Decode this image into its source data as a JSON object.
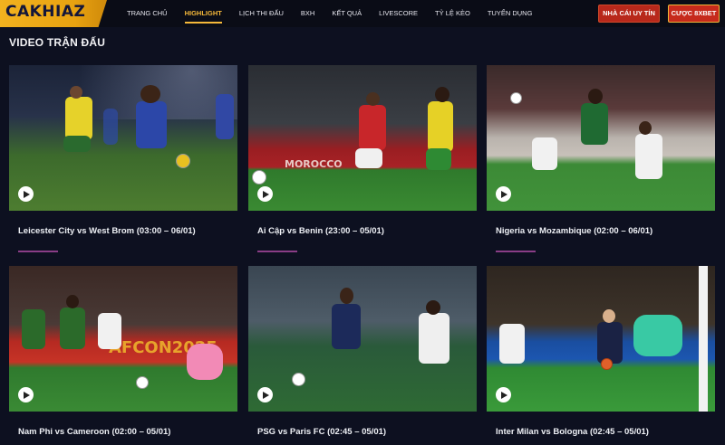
{
  "brand": {
    "logo_text": "CAKHIAZ"
  },
  "nav": {
    "items": [
      {
        "label": "TRANG CHỦ",
        "active": false
      },
      {
        "label": "HIGHLIGHT",
        "active": true
      },
      {
        "label": "LỊCH THI ĐẤU",
        "active": false
      },
      {
        "label": "BXH",
        "active": false
      },
      {
        "label": "KẾT QUẢ",
        "active": false
      },
      {
        "label": "LIVESCORE",
        "active": false
      },
      {
        "label": "TỶ LỆ KÈO",
        "active": false
      },
      {
        "label": "TUYỂN DỤNG",
        "active": false
      }
    ],
    "button_primary": "NHÀ CÁI UY TÍN",
    "button_secondary": "CƯỢC 8XBET"
  },
  "section": {
    "title": "VIDEO TRẬN ĐẤU"
  },
  "videos": [
    {
      "title": "Leicester City vs West Brom (03:00 – 06/01)"
    },
    {
      "title": "Ai Cập vs Benin (23:00 – 05/01)"
    },
    {
      "title": "Nigeria vs Mozambique (02:00 – 06/01)"
    },
    {
      "title": "Nam Phi vs Cameroon (02:00 – 05/01)"
    },
    {
      "title": "PSG vs Paris FC (02:45 – 05/01)"
    },
    {
      "title": "Inter Milan vs Bologna (02:45 – 05/01)"
    }
  ],
  "colors": {
    "accent": "#f5b83a",
    "button_red": "#c62a1c",
    "background": "#0d1020",
    "underline": "#8a3d86"
  },
  "icons": {
    "play": "play-icon"
  }
}
